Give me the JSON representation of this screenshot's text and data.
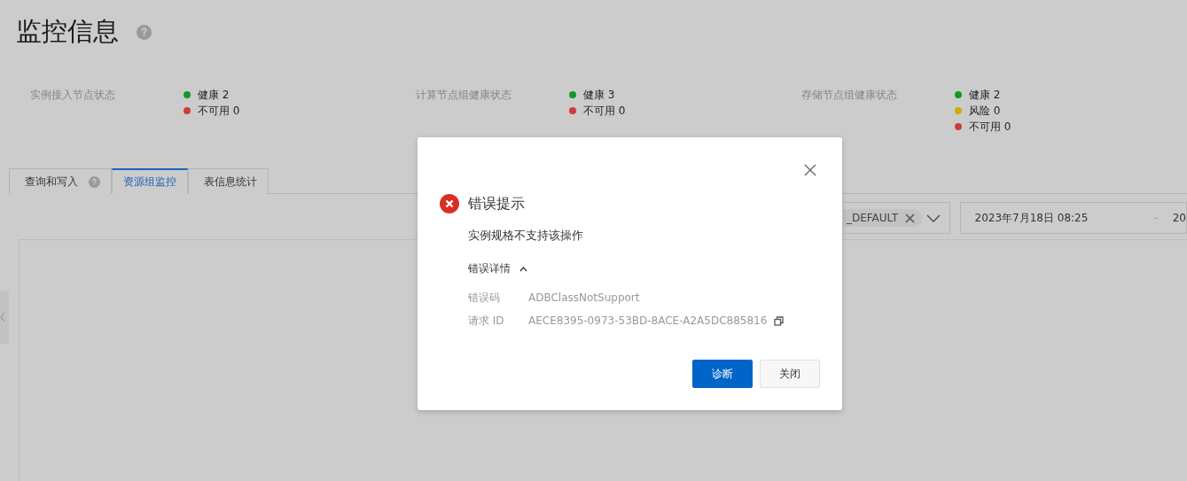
{
  "page_title": "监控信息",
  "status_groups": [
    {
      "label": "实例接入节点状态",
      "items": [
        {
          "text": "健康 2",
          "color": "#119a26"
        },
        {
          "text": "不可用 0",
          "color": "#cf3b3b"
        }
      ]
    },
    {
      "label": "计算节点组健康状态",
      "items": [
        {
          "text": "健康 3",
          "color": "#119a26"
        },
        {
          "text": "不可用 0",
          "color": "#cf3b3b"
        }
      ]
    },
    {
      "label": "存储节点组健康状态",
      "items": [
        {
          "text": "健康 2",
          "color": "#119a26"
        },
        {
          "text": "风险 0",
          "color": "#d6a808"
        },
        {
          "text": "不可用 0",
          "color": "#cf3b3b"
        }
      ]
    }
  ],
  "tabs": [
    {
      "label": "查询和写入",
      "help": true,
      "selected": false
    },
    {
      "label": "资源组监控",
      "help": false,
      "selected": true
    },
    {
      "label": "表信息统计",
      "help": false,
      "selected": false
    }
  ],
  "toolbar": {
    "resource_group_tag": "_DEFAULT",
    "time_start": "2023年7月18日 08:25",
    "time_separator": "-",
    "time_end": "20"
  },
  "dialog": {
    "title": "错误提示",
    "message": "实例规格不支持该操作",
    "details_label": "错误详情",
    "details_expanded": true,
    "details": [
      {
        "label": "错误码",
        "value": "ADBClassNotSupport",
        "copyable": false
      },
      {
        "label": "请求 ID",
        "value": "AECE8395-0973-53BD-8ACE-A2A5DC885816",
        "copyable": true
      }
    ],
    "buttons": [
      {
        "label": "诊断",
        "kind": "primary"
      },
      {
        "label": "关闭",
        "kind": "secondary"
      }
    ]
  }
}
